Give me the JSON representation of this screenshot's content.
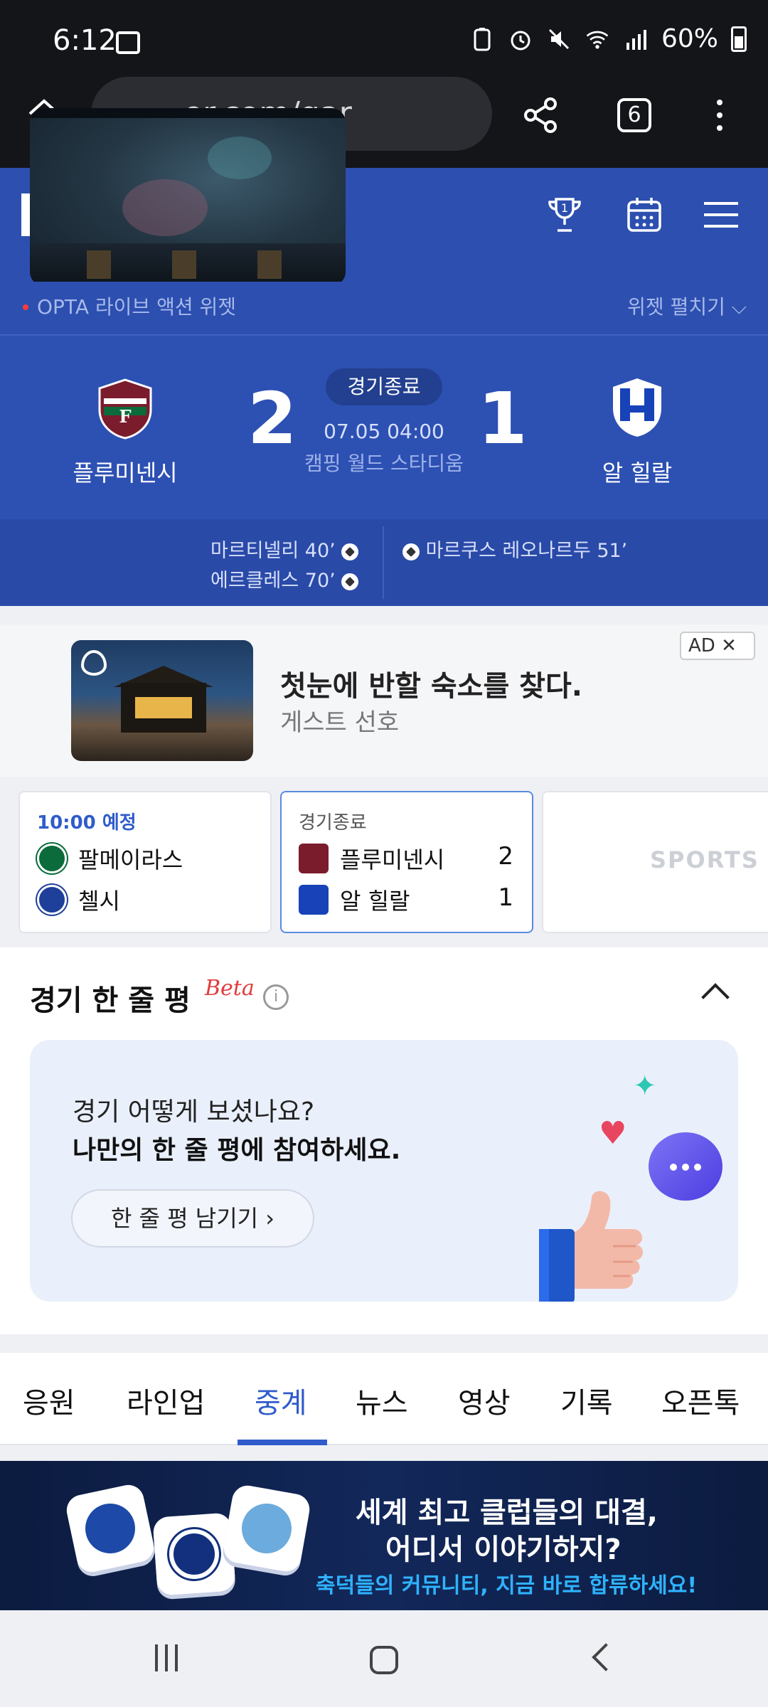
{
  "status_bar": {
    "time": "6:12",
    "battery": "60%"
  },
  "browser": {
    "url": "er.com/gar",
    "tab_count": "6"
  },
  "widget": {
    "label": "OPTA 라이브 액션 위젯",
    "expand": "위젯 펼치기"
  },
  "match": {
    "status": "경기종료",
    "datetime": "07.05 04:00",
    "venue": "캠핑 월드 스타디움",
    "home": {
      "name": "플루미넨시",
      "score": "2",
      "color": "#7b1c2c"
    },
    "away": {
      "name": "알 힐랄",
      "score": "1",
      "color": "#1742b8"
    },
    "home_scorers": [
      "마르티넬리 40’",
      "에르클레스 70’"
    ],
    "away_scorers": [
      "마르쿠스 레오나르두 51’"
    ]
  },
  "ad": {
    "badge": "AD",
    "close": "✕",
    "title": "첫눈에 반할 숙소를 찾다.",
    "subtitle": "게스트 선호"
  },
  "cards": [
    {
      "status": "10:00 예정",
      "status_color": "#2f5bcb",
      "team1": "팔메이라스",
      "team2": "첼시",
      "score1": "",
      "score2": ""
    },
    {
      "status": "경기종료",
      "status_color": "#555555",
      "team1": "플루미넨시",
      "team2": "알 힐랄",
      "score1": "2",
      "score2": "1"
    },
    {
      "placeholder": "SPORTS"
    }
  ],
  "review": {
    "title": "경기 한 줄 평",
    "beta": "Beta",
    "question": "경기 어떻게 보셨나요?",
    "prompt": "나만의 한 줄 평에 참여하세요.",
    "button": "한 줄 평 남기기 ›"
  },
  "tabs": [
    "응원",
    "라인업",
    "중계",
    "뉴스",
    "영상",
    "기록",
    "오픈톡"
  ],
  "active_tab": "중계",
  "banner": {
    "line1": "세계 최고 클럽들의 대결,",
    "line2": "어디서 이야기하지?",
    "line3": "축덕들의 커뮤니티, 지금 바로 합류하세요!"
  }
}
